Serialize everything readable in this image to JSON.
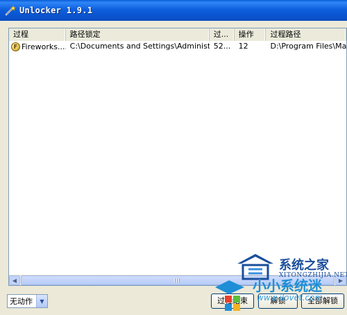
{
  "window": {
    "title": "Unlocker 1.9.1"
  },
  "columns": [
    {
      "label": "过程"
    },
    {
      "label": "路径锁定"
    },
    {
      "label": "过..."
    },
    {
      "label": "操作"
    },
    {
      "label": "过程路径"
    }
  ],
  "rows": [
    {
      "process": "Fireworks....",
      "path": "C:\\Documents and Settings\\Administrat...",
      "pid": "52...",
      "handle": "12",
      "process_path": "D:\\Program Files\\Macromedia\\Fireworks"
    }
  ],
  "action_select": {
    "value": "无动作"
  },
  "buttons": {
    "kill": "过程结束",
    "unlock": "解锁",
    "unlock_all": "全部解锁"
  },
  "watermarks": {
    "site1_name": "系统之家",
    "site1_sub": "XITONGZHIJIA.NET",
    "site2_name": "小小系统迷",
    "site2_url": "www.ilovet.com"
  },
  "colors": {
    "titlebar": "#0a5fd6",
    "watermark_dark": "#1b4f9c",
    "watermark_light": "#1e8fd6"
  }
}
